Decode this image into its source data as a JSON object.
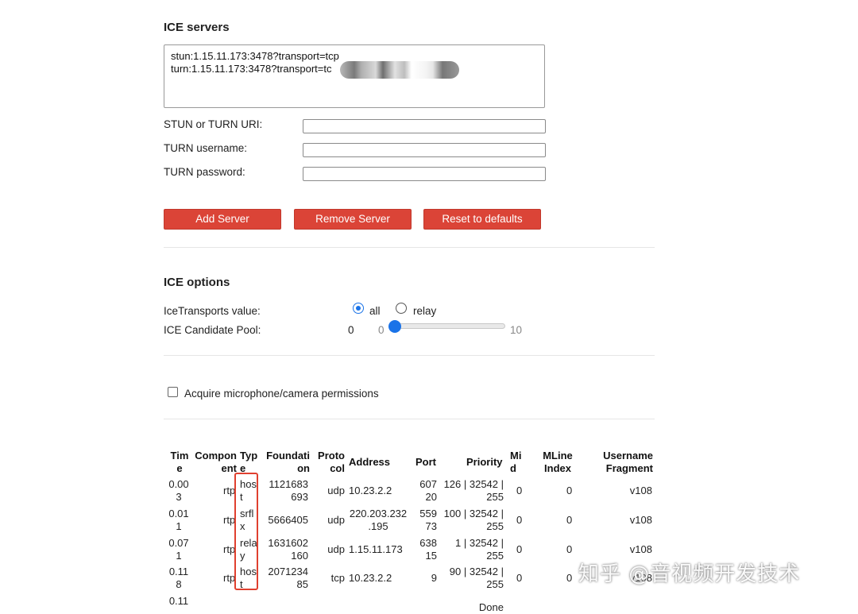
{
  "ice_servers": {
    "heading": "ICE servers",
    "lines": [
      "stun:1.15.11.173:3478?transport=tcp",
      "turn:1.15.11.173:3478?transport=tc"
    ],
    "uri_label": "STUN or TURN URI:",
    "username_label": "TURN username:",
    "password_label": "TURN password:",
    "add_label": "Add Server",
    "remove_label": "Remove Server",
    "reset_label": "Reset to defaults"
  },
  "ice_options": {
    "heading": "ICE options",
    "transports_label": "IceTransports value:",
    "opt_all": "all",
    "opt_relay": "relay",
    "selected": "all",
    "pool_label": "ICE Candidate Pool:",
    "pool_value": "0",
    "slider_min": "0",
    "slider_max": "10",
    "slider_level": 0
  },
  "permissions": {
    "label": "Acquire microphone/camera permissions",
    "checked": false
  },
  "candidates": {
    "headers": {
      "time": [
        "Tim",
        "e"
      ],
      "component": [
        "Compon",
        "ent"
      ],
      "type": [
        "Typ",
        "e"
      ],
      "foundation": [
        "Foundati",
        "on"
      ],
      "protocol": [
        "Proto",
        "col"
      ],
      "address": "Address",
      "port": "Port",
      "priority": "Priority",
      "mid": [
        "Mi",
        "d"
      ],
      "mline": [
        "MLine",
        "Index"
      ],
      "ufrag": [
        "Username",
        "Fragment"
      ]
    },
    "rows": [
      {
        "time": [
          "0.00",
          "3"
        ],
        "component": "rtp",
        "type": [
          "hos",
          "t"
        ],
        "foundation": [
          "1121683",
          "693"
        ],
        "protocol": "udp",
        "address": [
          "10.23.2.2"
        ],
        "port": [
          "607",
          "20"
        ],
        "priority": [
          "126 | 32542 |",
          "255"
        ],
        "mid": "0",
        "mline": "0",
        "ufrag": "v108"
      },
      {
        "time": [
          "0.01",
          "1"
        ],
        "component": "rtp",
        "type": [
          "srfl",
          "x"
        ],
        "foundation": [
          "5666405"
        ],
        "protocol": "udp",
        "address": [
          "220.203.232",
          ".195"
        ],
        "port": [
          "559",
          "73"
        ],
        "priority": [
          "100 | 32542 |",
          "255"
        ],
        "mid": "0",
        "mline": "0",
        "ufrag": "v108"
      },
      {
        "time": [
          "0.07",
          "1"
        ],
        "component": "rtp",
        "type": [
          "rela",
          "y"
        ],
        "foundation": [
          "1631602",
          "160"
        ],
        "protocol": "udp",
        "address": [
          "1.15.11.173"
        ],
        "port": [
          "638",
          "15"
        ],
        "priority": [
          "1 | 32542 |",
          "255"
        ],
        "mid": "0",
        "mline": "0",
        "ufrag": "v108"
      },
      {
        "time": [
          "0.11",
          "8"
        ],
        "component": "rtp",
        "type": [
          "hos",
          "t"
        ],
        "foundation": [
          "2071234",
          "85"
        ],
        "protocol": "tcp",
        "address": [
          "10.23.2.2"
        ],
        "port": [
          "9"
        ],
        "priority": [
          "90 | 32542 |",
          "255"
        ],
        "mid": "0",
        "mline": "0",
        "ufrag": "v108"
      }
    ],
    "partial_row": {
      "time": "0.11",
      "priority": "Done"
    }
  },
  "watermark": "知乎 @音视频开发技术"
}
